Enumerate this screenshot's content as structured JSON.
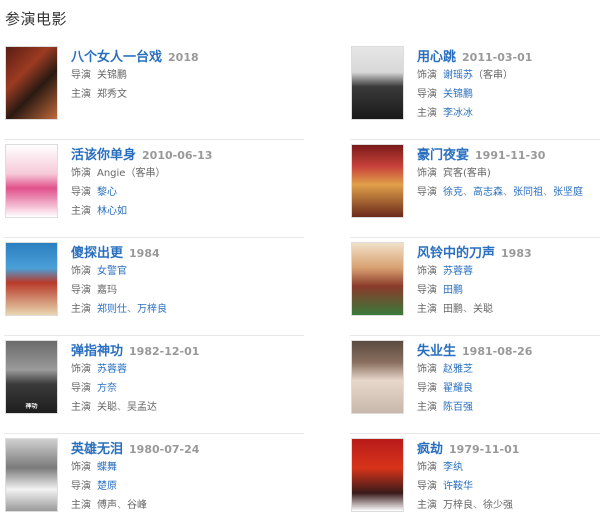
{
  "section": {
    "title": "参演电影"
  },
  "colors": {
    "link": "#2a6fbf",
    "label": "#666666",
    "date": "#999999",
    "divider": "#e8e8e8"
  },
  "films": [
    {
      "title": "八个女人一台戏",
      "date": "2018",
      "rows": [
        {
          "label": "导演",
          "names": [
            {
              "text": "关锦鹏",
              "link": false
            }
          ]
        },
        {
          "label": "主演",
          "names": [
            {
              "text": "郑秀文",
              "link": false
            }
          ]
        }
      ],
      "poster": {
        "bg": "linear-gradient(135deg,#5a1d14 0%,#9c3b22 35%,#2a1a12 60%,#c06a3a 100%)",
        "caption": "",
        "caption_color": "#fff"
      }
    },
    {
      "title": "用心跳",
      "date": "2011-03-01",
      "rows": [
        {
          "label": "饰演",
          "names": [
            {
              "text": "谢瑶苏",
              "link": true
            }
          ],
          "note": "（客串）"
        },
        {
          "label": "导演",
          "names": [
            {
              "text": "关锦鹏",
              "link": true
            }
          ]
        },
        {
          "label": "主演",
          "names": [
            {
              "text": "李冰冰",
              "link": true
            }
          ]
        }
      ],
      "poster": {
        "bg": "linear-gradient(180deg,#e6e6e6 0%,#d8d8d8 35%,#3a3a3a 55%,#1a1a1a 100%)",
        "caption": "",
        "caption_color": "#fff"
      }
    },
    {
      "title": "活该你单身",
      "date": "2010-06-13",
      "rows": [
        {
          "label": "饰演",
          "names": [
            {
              "text": "Angie",
              "link": false
            }
          ],
          "note": "（客串）"
        },
        {
          "label": "导演",
          "names": [
            {
              "text": "黎心",
              "link": true
            }
          ]
        },
        {
          "label": "主演",
          "names": [
            {
              "text": "林心如",
              "link": true
            }
          ]
        }
      ],
      "poster": {
        "bg": "linear-gradient(180deg,#ffffff 0%,#f6c9d8 40%,#e0508a 60%,#ffffff 100%)",
        "caption": "",
        "caption_color": "#c2185b"
      }
    },
    {
      "title": "豪门夜宴",
      "date": "1991-11-30",
      "rows": [
        {
          "label": "饰演",
          "names": [
            {
              "text": "宾客",
              "link": false
            }
          ],
          "note": "(客串)"
        },
        {
          "label": "导演",
          "names": [
            {
              "text": "徐克",
              "link": true
            },
            {
              "text": "高志森",
              "link": true
            },
            {
              "text": "张同祖",
              "link": true
            },
            {
              "text": "张坚庭",
              "link": true
            }
          ]
        }
      ],
      "poster": {
        "bg": "linear-gradient(180deg,#7a1a1a 0%,#c8423a 30%,#e0a04a 55%,#6a2a1a 100%)",
        "caption": "",
        "caption_color": "#ffec70"
      }
    },
    {
      "title": "傻探出更",
      "date": "1984",
      "rows": [
        {
          "label": "饰演",
          "names": [
            {
              "text": "女警官",
              "link": true
            }
          ]
        },
        {
          "label": "导演",
          "names": [
            {
              "text": "嘉玛",
              "link": false
            }
          ]
        },
        {
          "label": "主演",
          "names": [
            {
              "text": "郑则仕",
              "link": true
            },
            {
              "text": "万梓良",
              "link": true
            }
          ]
        }
      ],
      "poster": {
        "bg": "linear-gradient(180deg,#2b7fbf 0%,#4aa0d8 35%,#b83a2a 55%,#e8d6b0 100%)",
        "caption": "",
        "caption_color": "#fff"
      }
    },
    {
      "title": "风铃中的刀声",
      "date": "1983",
      "rows": [
        {
          "label": "饰演",
          "names": [
            {
              "text": "苏蓉蓉",
              "link": true
            }
          ]
        },
        {
          "label": "导演",
          "names": [
            {
              "text": "田鹏",
              "link": true
            }
          ]
        },
        {
          "label": "主演",
          "names": [
            {
              "text": "田鹏",
              "link": false
            },
            {
              "text": "关聪",
              "link": false
            }
          ]
        }
      ],
      "poster": {
        "bg": "linear-gradient(180deg,#f0e0c8 0%,#d8a070 35%,#8a3a2a 60%,#3a7a3a 100%)",
        "caption": "",
        "caption_color": "#fff"
      }
    },
    {
      "title": "弹指神功",
      "date": "1982-12-01",
      "rows": [
        {
          "label": "饰演",
          "names": [
            {
              "text": "苏蓉蓉",
              "link": true
            }
          ]
        },
        {
          "label": "导演",
          "names": [
            {
              "text": "方奈",
              "link": true
            }
          ]
        },
        {
          "label": "主演",
          "names": [
            {
              "text": "关聪",
              "link": false
            },
            {
              "text": "吴孟达",
              "link": false
            }
          ]
        }
      ],
      "poster": {
        "bg": "linear-gradient(180deg,#6a6a6a 0%,#9a9a9a 40%,#3a3a3a 60%,#1e1e1e 100%)",
        "caption": "神功",
        "caption_color": "#fff"
      }
    },
    {
      "title": "失业生",
      "date": "1981-08-26",
      "rows": [
        {
          "label": "饰演",
          "names": [
            {
              "text": "赵雅芝",
              "link": true
            }
          ]
        },
        {
          "label": "导演",
          "names": [
            {
              "text": "翟耀良",
              "link": true
            }
          ]
        },
        {
          "label": "主演",
          "names": [
            {
              "text": "陈百强",
              "link": true
            }
          ]
        }
      ],
      "poster": {
        "bg": "linear-gradient(180deg,#5a4a40 0%,#8a7060 30%,#e8d8cc 55%,#c8b8aa 100%)",
        "caption": "",
        "caption_color": "#fff"
      }
    },
    {
      "title": "英雄无泪",
      "date": "1980-07-24",
      "rows": [
        {
          "label": "饰演",
          "names": [
            {
              "text": "蝶舞",
              "link": true
            }
          ]
        },
        {
          "label": "导演",
          "names": [
            {
              "text": "楚原",
              "link": true
            }
          ]
        },
        {
          "label": "主演",
          "names": [
            {
              "text": "傅声",
              "link": false
            },
            {
              "text": "谷峰",
              "link": false
            }
          ]
        }
      ],
      "poster": {
        "bg": "linear-gradient(180deg,#d0d0d0 0%,#7a7a7a 40%,#f2f2f2 70%,#9a9a9a 100%)",
        "caption": "",
        "caption_color": "#333"
      }
    },
    {
      "title": "疯劫",
      "date": "1979-11-01",
      "rows": [
        {
          "label": "饰演",
          "names": [
            {
              "text": "李纨",
              "link": true
            }
          ]
        },
        {
          "label": "导演",
          "names": [
            {
              "text": "许鞍华",
              "link": true
            }
          ]
        },
        {
          "label": "主演",
          "names": [
            {
              "text": "万梓良",
              "link": false
            },
            {
              "text": "徐少强",
              "link": false
            }
          ]
        }
      ],
      "poster": {
        "bg": "linear-gradient(180deg,#b81a1a 0%,#d8341a 40%,#3a1a1a 75%,#ffffff 100%)",
        "caption": "",
        "caption_color": "#fff"
      }
    }
  ]
}
